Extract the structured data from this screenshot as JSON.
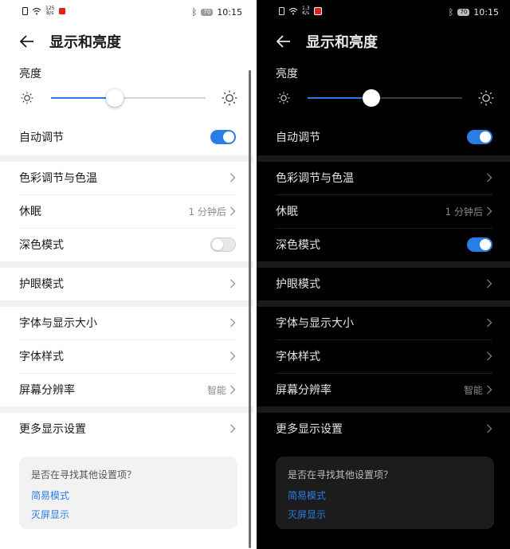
{
  "status": {
    "speed_light": "125\nB/s",
    "speed_dark": "1.3\nK/s",
    "battery": "70",
    "time": "10:15"
  },
  "header": {
    "title": "显示和亮度"
  },
  "brightness": {
    "label": "亮度",
    "level_light": 0.41,
    "level_dark": 0.41
  },
  "settings": {
    "auto_adjust": "自动调节",
    "color_temp": "色彩调节与色温",
    "sleep": "休眠",
    "sleep_value": "1 分钟后",
    "dark_mode": "深色模式",
    "eye_comfort": "护眼模式",
    "font_size": "字体与显示大小",
    "font_style": "字体样式",
    "resolution": "屏幕分辨率",
    "resolution_value": "智能",
    "more_display": "更多显示设置"
  },
  "toggles": {
    "light": {
      "auto_adjust": true,
      "dark_mode": false
    },
    "dark": {
      "auto_adjust": true,
      "dark_mode": true
    }
  },
  "suggest": {
    "question": "是否在寻找其他设置项？",
    "link1": "简易模式",
    "link2": "灭屏显示"
  },
  "colors": {
    "accent": "#2a7de6",
    "light_bg": "#ffffff",
    "dark_bg": "#000000"
  },
  "icons": [
    "back-arrow-icon",
    "sun-small-icon",
    "sun-large-icon",
    "chevron-right-icon",
    "wifi-icon",
    "sim-icon",
    "bluetooth-icon",
    "battery-icon"
  ]
}
